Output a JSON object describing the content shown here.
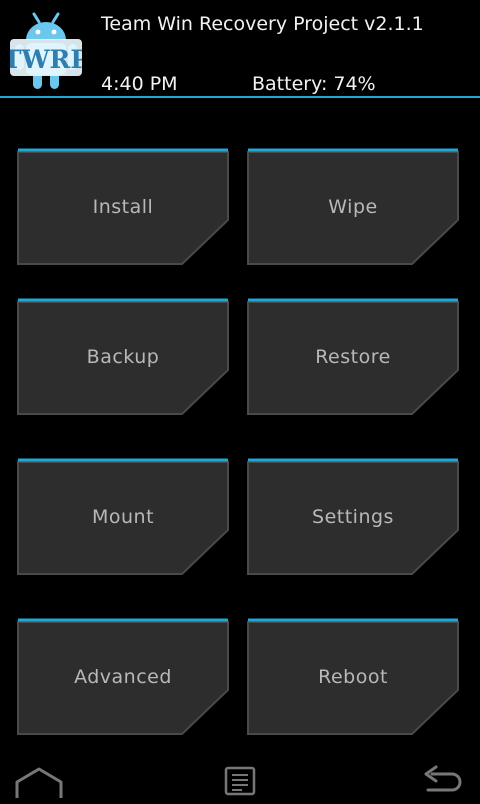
{
  "header": {
    "title": "Team Win Recovery Project  v2.1.1",
    "time": "4:40 PM",
    "battery": "Battery: 74%",
    "logo_text": "TWRP"
  },
  "colors": {
    "accent": "#1fa7d6",
    "tile_fill": "#2d2d2d",
    "tile_border": "#4a4a4a",
    "text": "#f2f2f2",
    "tile_text": "#b8b8b8"
  },
  "menu": [
    {
      "label": "Install"
    },
    {
      "label": "Wipe"
    },
    {
      "label": "Backup"
    },
    {
      "label": "Restore"
    },
    {
      "label": "Mount"
    },
    {
      "label": "Settings"
    },
    {
      "label": "Advanced"
    },
    {
      "label": "Reboot"
    }
  ],
  "navbar": {
    "home_icon": "home-icon",
    "console_icon": "console-icon",
    "back_icon": "back-icon"
  }
}
